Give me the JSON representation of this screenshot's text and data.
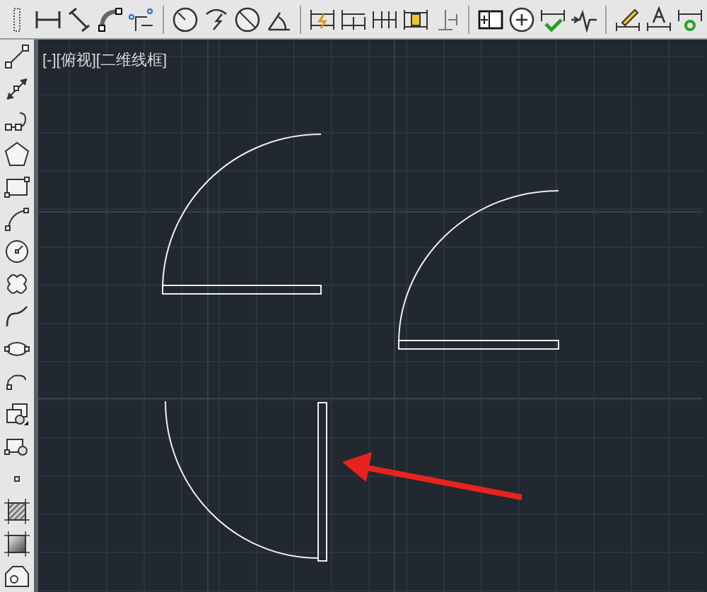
{
  "viewport": {
    "controls": [
      {
        "label": "[-]"
      },
      {
        "label": "[俯视]"
      },
      {
        "label": "[二维线框]"
      }
    ]
  }
}
